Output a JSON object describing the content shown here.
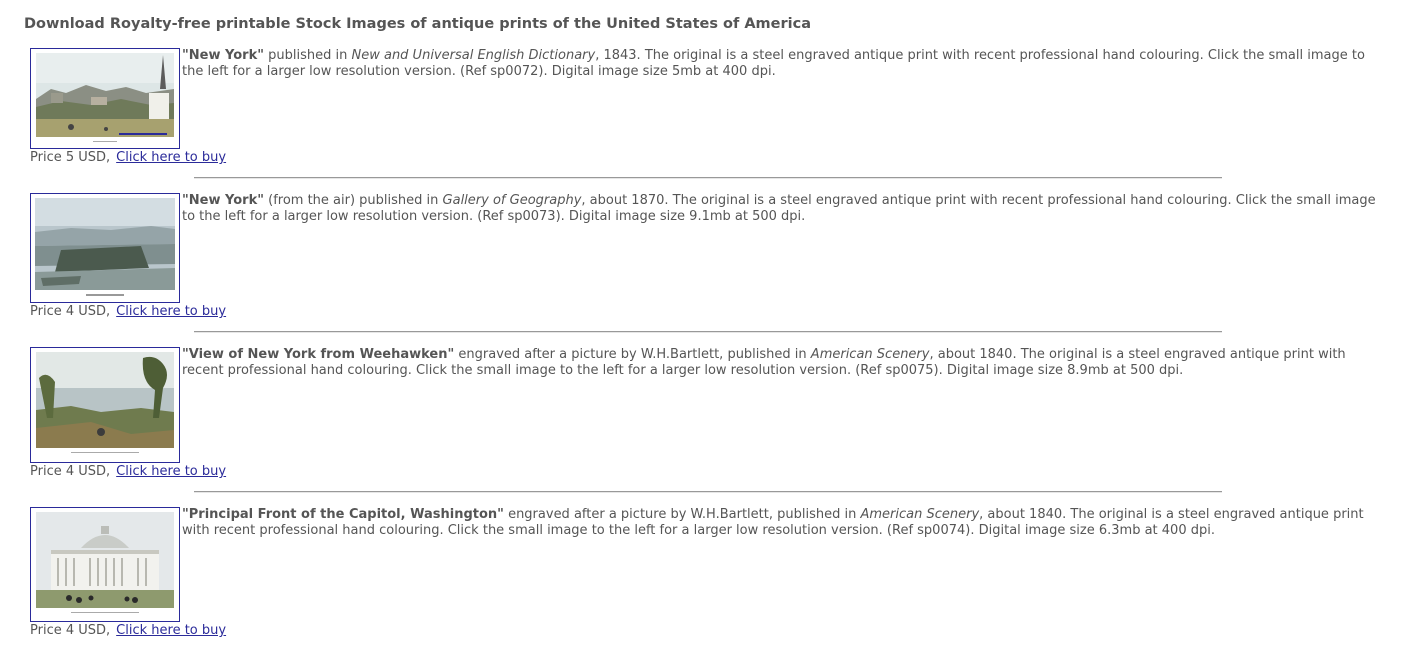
{
  "page": {
    "heading": "Download Royalty-free printable Stock Images of antique prints of the United States of America"
  },
  "items": [
    {
      "title": "\"New York\"",
      "pre": " published in ",
      "publication": "New and Universal English Dictionary",
      "post": ", 1843. The original is a steel engraved antique print with recent professional hand colouring. Click the small image to the left for a larger low resolution version. (Ref sp0072). Digital image size 5mb at 400 dpi.",
      "price": "Price 5 USD,",
      "buy_label": "Click here to buy",
      "thumb_icon": "new-york-print-thumbnail"
    },
    {
      "title": "\"New York\"",
      "pre": " (from the air) published in ",
      "publication": "Gallery of Geography",
      "post": ", about 1870. The original is a steel engraved antique print with recent professional hand colouring. Click the small image to the left for a larger low resolution version. (Ref sp0073). Digital image size 9.1mb at 500 dpi.",
      "price": "Price 4 USD,",
      "buy_label": "Click here to buy",
      "thumb_icon": "new-york-aerial-print-thumbnail"
    },
    {
      "title": "\"View of New York from Weehawken\"",
      "pre": " engraved after a picture by W.H.Bartlett, published in ",
      "publication": "American Scenery",
      "post": ", about 1840. The original is a steel engraved antique print with recent professional hand colouring. Click the small image to the left for a larger low resolution version. (Ref sp0075). Digital image size 8.9mb at 500 dpi.",
      "price": "Price 4 USD,",
      "buy_label": "Click here to buy",
      "thumb_icon": "weehawken-print-thumbnail"
    },
    {
      "title": "\"Principal Front of the Capitol, Washington\"",
      "pre": " engraved after a picture by W.H.Bartlett, published in ",
      "publication": "American Scenery",
      "post": ", about 1840. The original is a steel engraved antique print with recent professional hand colouring. Click the small image to the left for a larger low resolution version. (Ref sp0074). Digital image size 6.3mb at 400 dpi.",
      "price": "Price 4 USD,",
      "buy_label": "Click here to buy",
      "thumb_icon": "capitol-washington-print-thumbnail"
    }
  ],
  "colors": {
    "text": "#555555",
    "link": "#2b2b9a",
    "thumb_border": "#2a2a9a",
    "rule": "#999999"
  }
}
